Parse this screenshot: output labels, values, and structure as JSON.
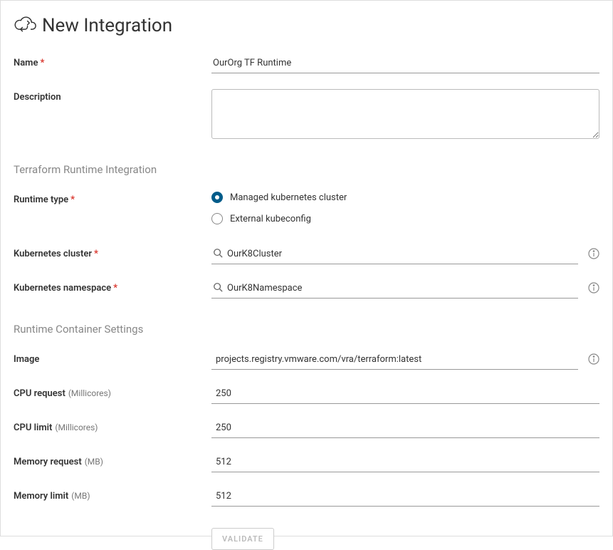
{
  "header": {
    "title": "New Integration"
  },
  "fields": {
    "name": {
      "label": "Name",
      "value": "OurOrg TF Runtime"
    },
    "description": {
      "label": "Description",
      "value": ""
    }
  },
  "section1": {
    "title": "Terraform Runtime Integration",
    "runtimeType": {
      "label": "Runtime type",
      "options": {
        "managed": "Managed kubernetes cluster",
        "external": "External kubeconfig"
      }
    },
    "cluster": {
      "label": "Kubernetes cluster",
      "value": "OurK8Cluster"
    },
    "namespace": {
      "label": "Kubernetes namespace",
      "value": "OurK8Namespace"
    }
  },
  "section2": {
    "title": "Runtime Container Settings",
    "image": {
      "label": "Image",
      "value": "projects.registry.vmware.com/vra/terraform:latest"
    },
    "cpuRequest": {
      "label": "CPU request",
      "unit": "(Millicores)",
      "value": "250"
    },
    "cpuLimit": {
      "label": "CPU limit",
      "unit": "(Millicores)",
      "value": "250"
    },
    "memRequest": {
      "label": "Memory request",
      "unit": "(MB)",
      "value": "512"
    },
    "memLimit": {
      "label": "Memory limit",
      "unit": "(MB)",
      "value": "512"
    }
  },
  "buttons": {
    "validate": "Validate"
  }
}
